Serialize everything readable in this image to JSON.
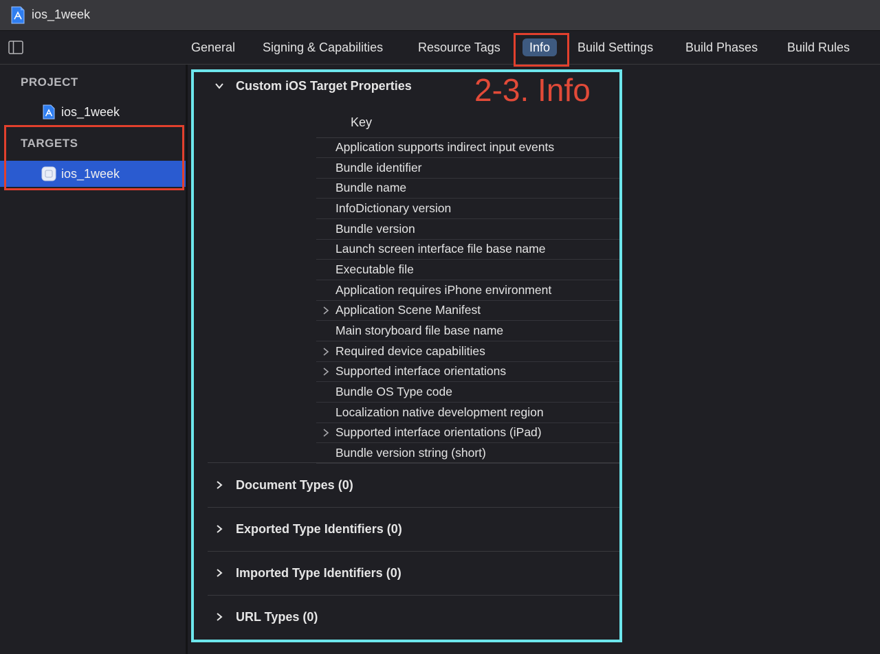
{
  "window": {
    "title": "ios_1week"
  },
  "tabs": [
    {
      "label": "General"
    },
    {
      "label": "Signing & Capabilities"
    },
    {
      "label": "Resource Tags"
    },
    {
      "label": "Info"
    },
    {
      "label": "Build Settings"
    },
    {
      "label": "Build Phases"
    },
    {
      "label": "Build Rules"
    }
  ],
  "active_tab": "Info",
  "sidebar": {
    "project_header": "PROJECT",
    "project_item": "ios_1week",
    "targets_header": "TARGETS",
    "target_item": "ios_1week"
  },
  "annotation": "2-3. Info",
  "custom_props": {
    "title": "Custom iOS Target Properties",
    "key_header": "Key",
    "rows": [
      {
        "key": "Application supports indirect input events",
        "expandable": false
      },
      {
        "key": "Bundle identifier",
        "expandable": false
      },
      {
        "key": "Bundle name",
        "expandable": false
      },
      {
        "key": "InfoDictionary version",
        "expandable": false
      },
      {
        "key": "Bundle version",
        "expandable": false
      },
      {
        "key": "Launch screen interface file base name",
        "expandable": false
      },
      {
        "key": "Executable file",
        "expandable": false
      },
      {
        "key": "Application requires iPhone environment",
        "expandable": false
      },
      {
        "key": "Application Scene Manifest",
        "expandable": true
      },
      {
        "key": "Main storyboard file base name",
        "expandable": false
      },
      {
        "key": "Required device capabilities",
        "expandable": true
      },
      {
        "key": "Supported interface orientations",
        "expandable": true
      },
      {
        "key": "Bundle OS Type code",
        "expandable": false
      },
      {
        "key": "Localization native development region",
        "expandable": false
      },
      {
        "key": "Supported interface orientations (iPad)",
        "expandable": true
      },
      {
        "key": "Bundle version string (short)",
        "expandable": false
      }
    ]
  },
  "sections": [
    {
      "title": "Document Types (0)"
    },
    {
      "title": "Exported Type Identifiers (0)"
    },
    {
      "title": "Imported Type Identifiers (0)"
    },
    {
      "title": "URL Types (0)"
    }
  ],
  "colors": {
    "background": "#1f1f24",
    "selection": "#2a5bd0",
    "active_tab": "#3e5a80",
    "annotation_red": "#e24a38",
    "highlight_cyan": "#6de6ec"
  }
}
